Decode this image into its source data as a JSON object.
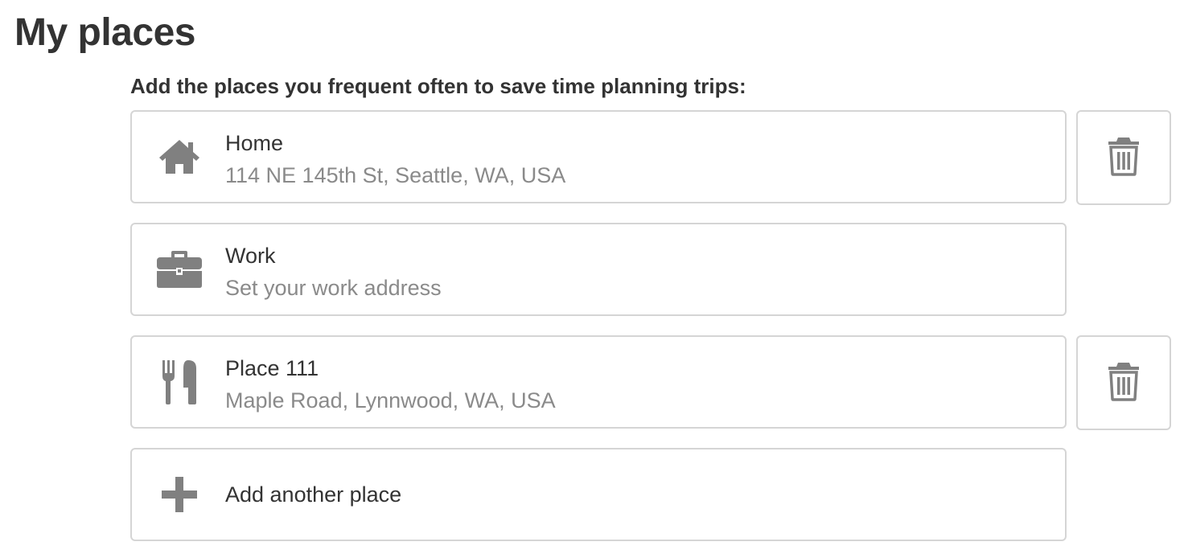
{
  "page": {
    "title": "My places",
    "instructions": "Add the places you frequent often to save time planning trips:"
  },
  "places": [
    {
      "name": "Home",
      "address": "114 NE 145th St, Seattle, WA, USA",
      "icon": "home-icon",
      "deletable": true
    },
    {
      "name": "Work",
      "address": "Set your work address",
      "icon": "briefcase-icon",
      "deletable": false
    },
    {
      "name": "Place 111",
      "address": "Maple Road, Lynnwood, WA, USA",
      "icon": "fork-knife-icon",
      "deletable": true
    }
  ],
  "add_place": {
    "label": "Add another place",
    "icon": "plus-icon"
  },
  "colors": {
    "text": "#333333",
    "muted_text": "#8a8a8a",
    "icon": "#808080",
    "border": "#d5d5d5"
  }
}
